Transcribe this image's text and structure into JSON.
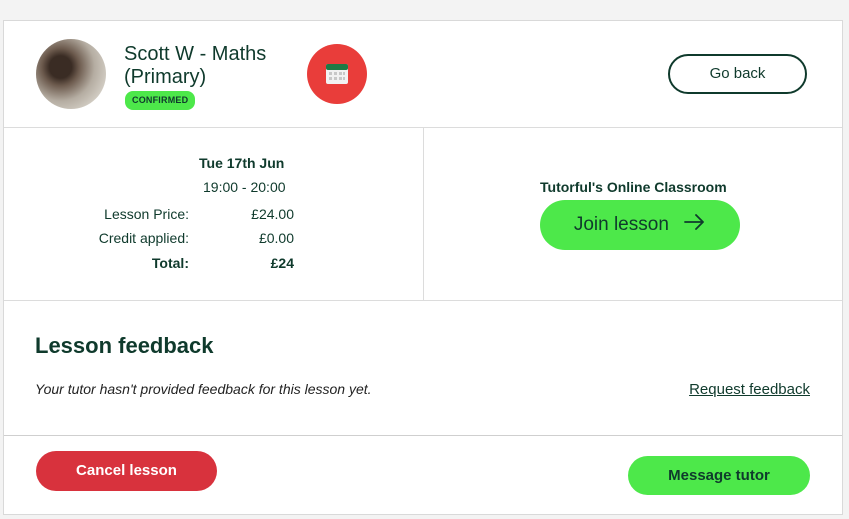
{
  "header": {
    "tutor_name": "Scott W - Maths (Primary)",
    "status_badge": "CONFIRMED",
    "go_back_label": "Go back",
    "icon": "calendar-icon"
  },
  "lesson": {
    "date": "Tue 17th Jun",
    "time": "19:00 - 20:00",
    "rows": [
      {
        "label": "Lesson Price:",
        "value": "£24.00"
      },
      {
        "label": "Credit applied:",
        "value": "£0.00"
      },
      {
        "label": "Total:",
        "value": "£24"
      }
    ]
  },
  "classroom": {
    "title": "Tutorful's Online Classroom",
    "join_label": "Join lesson"
  },
  "feedback": {
    "title": "Lesson feedback",
    "message": "Your tutor hasn't provided feedback for this lesson yet.",
    "request_label": "Request feedback"
  },
  "actions": {
    "cancel_label": "Cancel lesson",
    "message_label": "Message tutor"
  },
  "colors": {
    "brand_green": "#4de84a",
    "dark_green": "#0f3a2c",
    "danger_red": "#d8323d",
    "calendar_red": "#e93d3a"
  }
}
